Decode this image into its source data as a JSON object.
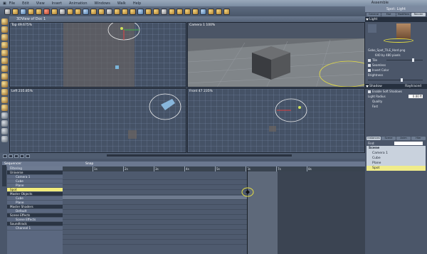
{
  "menubar": {
    "items": [
      "File",
      "Edit",
      "View",
      "Insert",
      "Animation",
      "Windows",
      "Walk",
      "Help"
    ],
    "mode": "Assemble"
  },
  "viewport": {
    "title": "3DView of Doc 1",
    "top_label": "Top 49.675%",
    "camera_label": "Camera 1 100%",
    "left_label": "Left 235.85%",
    "front_label": "Front 47 235%"
  },
  "right_panel": {
    "title": "Spot: Light",
    "tabs": [
      "General",
      "Mat",
      "Modifiers",
      "Render"
    ],
    "section_light": "Light",
    "gobo_name": "Gobo_Spot_TILE_Hard.png",
    "gobo_size": "640 by 480 pixels",
    "tile_label": "Tile",
    "seamless_label": "Seamless",
    "invert_label": "Invert Color",
    "brightness_label": "Brightness",
    "brightness_value": "100%",
    "section_shadow": "Shadow",
    "shadow_mode": "Raytraced",
    "soft_shadows_label": "Enable Soft Shadows",
    "light_radius_label": "Light Radius",
    "light_radius_value": "0.00 ft",
    "quality_label": "Quality",
    "quality_value": "Fast",
    "lower_tabs": [
      "Instances",
      "Scene",
      "Anim",
      "Hier"
    ],
    "filter_label": "Find:",
    "scene": {
      "title": "Scene",
      "items": [
        "Camera 1",
        "Cube",
        "Plane",
        "Spot"
      ],
      "selected": "Spot"
    }
  },
  "timeline": {
    "mode": "Sequencer",
    "filter_label": "Filtering",
    "snap_label": "Snap",
    "ruler_ticks": [
      "1s",
      "2s",
      "3s",
      "4s",
      "5s",
      "6s",
      "7s",
      "8s"
    ],
    "tracks": [
      {
        "label": "Universe",
        "type": "hdr"
      },
      {
        "label": "Camera 1",
        "type": "sub"
      },
      {
        "label": "Cube",
        "type": "sub"
      },
      {
        "label": "Plane",
        "type": "sub"
      },
      {
        "label": "Spot",
        "type": "sel"
      },
      {
        "label": "Master Objects",
        "type": "hdr"
      },
      {
        "label": "Cube",
        "type": "sub"
      },
      {
        "label": "Plane",
        "type": "sub"
      },
      {
        "label": "Master Shaders",
        "type": "hdr"
      },
      {
        "label": "Default",
        "type": "sub"
      },
      {
        "label": "Scene Effects",
        "type": "hdr"
      },
      {
        "label": "Scene Effects",
        "type": "sub"
      },
      {
        "label": "Soundtrack",
        "type": "hdr"
      },
      {
        "label": "Channel 1",
        "type": "sub"
      }
    ]
  },
  "colors": {
    "highlight": "#f0ec8a",
    "panel": "#4b5669",
    "viewport_bg": "#455266"
  }
}
